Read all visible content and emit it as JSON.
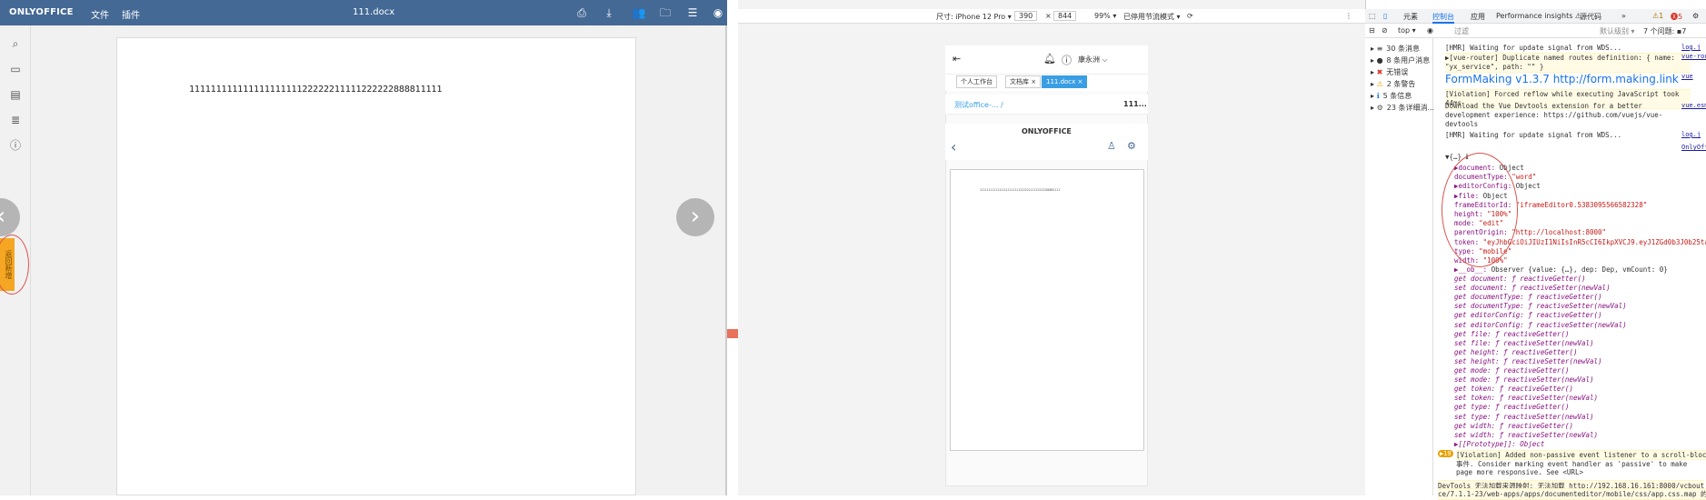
{
  "onlyoffice": {
    "logo": "ONLYOFFICE",
    "menu_file": "文件",
    "menu_plugins": "插件",
    "doc_title": "111.docx",
    "body_text": "11111111111111111111122222211111222222888811111",
    "side_tab": "返回新增",
    "icons": [
      "print-icon",
      "download-icon",
      "users-icon",
      "folder-icon",
      "menu-icon",
      "user-icon"
    ]
  },
  "devtools_bar": {
    "device": "尺寸: iPhone 12 Pro ▾",
    "width": "390",
    "x": "×",
    "height": "844",
    "zoom": "99% ▾",
    "throttle": "已停用节流模式 ▾"
  },
  "phone": {
    "user": "康永洲 ⌵",
    "tabs": [
      "个人工作台",
      "文档库 ×",
      "111.docx ×"
    ],
    "breadcrumb": "测试office-... /",
    "breadcrumb_right": "111...",
    "oo_logo": "ONLYOFFICE",
    "doc_snippet": "1111111111111111111111122222111112222288881111"
  },
  "console": {
    "tabs": [
      "元素",
      "控制台",
      "应用",
      "Performance insights ⚠",
      "源代码",
      "»"
    ],
    "badges": [
      "⚠1",
      "🅧5",
      "▪1"
    ],
    "top_ctx": "top ▾",
    "filter": "过滤",
    "levels": "默认级别 ▾",
    "issues": "7 个问题: ▪7",
    "sidebar": [
      {
        "icon": "≡",
        "label": "30 条消息"
      },
      {
        "icon": "●",
        "label": "8 条用户消息"
      },
      {
        "icon": "✖",
        "label": "无错误"
      },
      {
        "icon": "⚠",
        "label": "2 条警告"
      },
      {
        "icon": "ℹ",
        "label": "5 条信息"
      },
      {
        "icon": "⚙",
        "label": "23 条详细消..."
      }
    ],
    "lines": [
      {
        "text": "[HMR] Waiting for update signal from WDS...",
        "src": "log.j"
      },
      {
        "text": "▶[vue-router] Duplicate named routes definition: { name: \"yx_service\", path: \"\" }",
        "src": "vue-router.esm.j"
      },
      {
        "text": "FormMaking v1.3.7 http://form.making.link",
        "src": "vue"
      },
      {
        "text": "[Violation] Forced reflow while executing JavaScript took 44ms",
        "src": ""
      },
      {
        "text": "Download the Vue Devtools extension for a better development experience: https://github.com/vuejs/vue-devtools",
        "src": "vue.esm.js:"
      },
      {
        "text": "[HMR] Waiting for update signal from WDS...",
        "src": "log.j"
      },
      {
        "text": "",
        "src": "OnlyOffice.vue"
      },
      {
        "text": "▼{…} ℹ",
        "src": ""
      }
    ],
    "object_props": [
      [
        "▶document:",
        "Object"
      ],
      [
        "documentType:",
        "\"word\""
      ],
      [
        "▶editorConfig:",
        "Object"
      ],
      [
        "▶file:",
        "Object"
      ],
      [
        "frameEditorId:",
        "\"iframeEditor0.5383095566582328\""
      ],
      [
        "height:",
        "\"100%\""
      ],
      [
        "mode:",
        "\"edit\""
      ],
      [
        "parentOrigin:",
        "\"http://localhost:8000\""
      ],
      [
        "token:",
        "\"eyJhbGciOiJIUzI1NiIsInR5cCI6IkpXVCJ9.eyJ1ZGd0b3J0b25tamoci"
      ],
      [
        "type:",
        "\"mobile\""
      ],
      [
        "width:",
        "\"100%\""
      ],
      [
        "▶__ob__:",
        "Observer {value: {…}, dep: Dep, vmCount: 0}"
      ]
    ],
    "accessors": [
      "get document: ƒ reactiveGetter()",
      "set document: ƒ reactiveSetter(newVal)",
      "get documentType: ƒ reactiveGetter()",
      "set documentType: ƒ reactiveSetter(newVal)",
      "get editorConfig: ƒ reactiveGetter()",
      "set editorConfig: ƒ reactiveSetter(newVal)",
      "get file: ƒ reactiveGetter()",
      "set file: ƒ reactiveSetter(newVal)",
      "get height: ƒ reactiveGetter()",
      "set height: ƒ reactiveSetter(newVal)",
      "get mode: ƒ reactiveGetter()",
      "set mode: ƒ reactiveSetter(newVal)",
      "get token: ƒ reactiveGetter()",
      "set token: ƒ reactiveSetter(newVal)",
      "get type: ƒ reactiveGetter()",
      "set type: ƒ reactiveSetter(newVal)",
      "get width: ƒ reactiveGetter()",
      "set width: ƒ reactiveSetter(newVal)",
      "▶[[Prototype]]: Object"
    ],
    "violation2": "[Violation] Added non-passive event listener to a scroll-blocking",
    "violation2b": "事件. Consider marking event handler as 'passive' to make",
    "violation2c": "page more responsive. See <URL>",
    "violation_count": "▶19",
    "devtools_warn": "DevTools 无法加载来源映射: 无法加载 http://192.168.16.161:8000/ycbout",
    "devtools_warn2": "ce/7.1.1-23/web-apps/apps/documenteditor/mobile/css/app.css.map 的内容"
  }
}
